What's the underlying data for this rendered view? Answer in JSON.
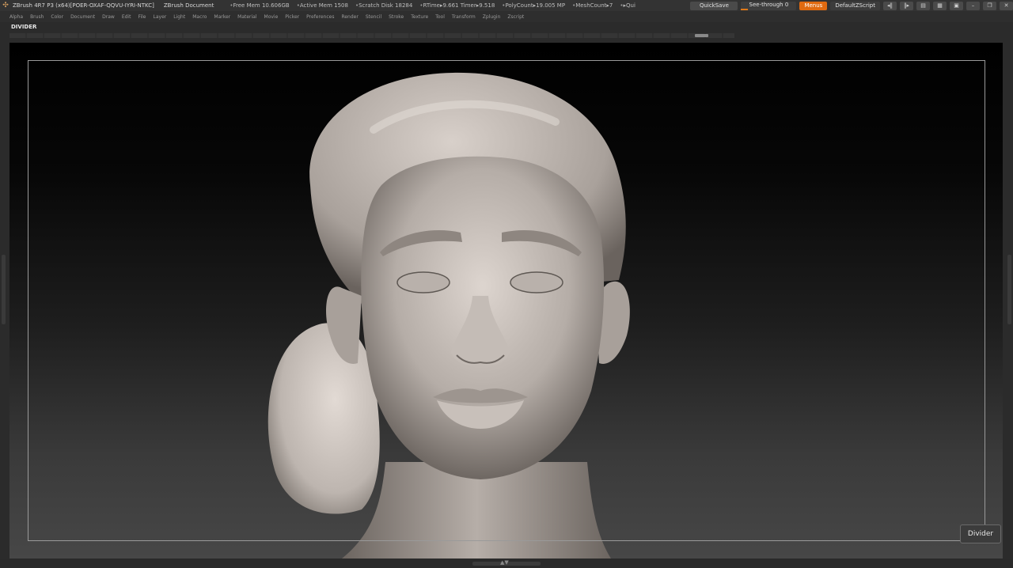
{
  "titlebar": {
    "app_title": "ZBrush 4R7 P3 (x64)[POER-OXAF-QQVU-IYRI-NTKC]",
    "document": "ZBrush Document",
    "stats": [
      "Free Mem 10.606GB",
      "Active Mem 1508",
      "Scratch Disk 18284",
      "RTime▸9.661 Timer▸9.518",
      "PolyCount▸19.005 MP",
      "MeshCount▸7",
      "▸Qui"
    ],
    "quicksave": "QuickSave",
    "see_through": "See-through",
    "see_through_value": "0",
    "see_through_fraction": 0.0,
    "menus": "Menus",
    "default_script": "DefaultZScript"
  },
  "menubar": {
    "items": [
      "Alpha",
      "Brush",
      "Color",
      "Document",
      "Draw",
      "Edit",
      "File",
      "Layer",
      "Light",
      "Macro",
      "Marker",
      "Material",
      "Movie",
      "Picker",
      "Preferences",
      "Render",
      "Stencil",
      "Stroke",
      "Texture",
      "Tool",
      "Transform",
      "Zplugin",
      "Zscript"
    ]
  },
  "tray": {
    "divider_label": "DIVIDER"
  },
  "tooltip": {
    "label": "Divider"
  },
  "colors": {
    "accent": "#e06a10",
    "background": "#2b2b2b",
    "sculpt_clay": "#c9c1bb"
  }
}
